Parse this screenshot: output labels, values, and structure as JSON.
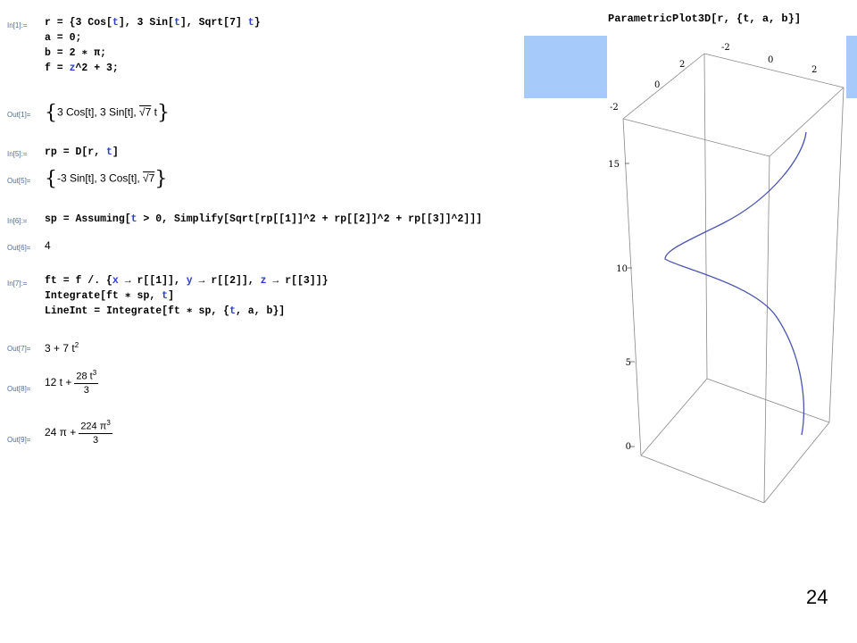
{
  "labels": {
    "in1": "In[1]:=",
    "out1": "Out[1]=",
    "in5": "In[5]:=",
    "out5": "Out[5]=",
    "in6": "In[6]:=",
    "out6": "Out[6]=",
    "in7": "In[7]:=",
    "out7": "Out[7]=",
    "out8": "Out[8]=",
    "out9": "Out[9]="
  },
  "cell1": {
    "line1_a": "r = {3 Cos[",
    "line1_t1": "t",
    "line1_b": "], 3 Sin[",
    "line1_t2": "t",
    "line1_c": "], Sqrt[7] ",
    "line1_t3": "t",
    "line1_d": "}",
    "line2": "a = 0;",
    "line3": "b = 2 ∗ π;",
    "line4_a": "f = ",
    "line4_z": "z",
    "line4_b": "^2 + 3;",
    "output_a": "3 Cos[t], 3 Sin[t], ",
    "output_sqrt": "√7",
    "output_b": " t"
  },
  "cell5": {
    "line1_a": "rp = D[r, ",
    "line1_t": "t",
    "line1_b": "]",
    "output_a": "-3 Sin[t], 3 Cos[t], ",
    "output_sqrt": "√7"
  },
  "cell6": {
    "line1_a": "sp = Assuming[",
    "line1_t": "t",
    "line1_b": " > 0, Simplify[Sqrt[rp[[1]]^2 + rp[[2]]^2 + rp[[3]]^2]]]",
    "output": "4"
  },
  "cell7": {
    "line1_a": "ft = f /. {",
    "line1_x": "x",
    "line1_b": " → r[[1]], ",
    "line1_y": "y",
    "line1_c": " → r[[2]], ",
    "line1_z": "z",
    "line1_d": " → r[[3]]}",
    "line2_a": "Integrate[ft ∗ sp, ",
    "line2_t": "t",
    "line2_b": "]",
    "line3_a": "LineInt = Integrate[ft ∗ sp, {",
    "line3_t": "t",
    "line3_b": ", a, b}]",
    "out7_base": "3 + 7 t",
    "out7_exp": "2",
    "out8_lead": "12 t +",
    "out8_num_base": "28 t",
    "out8_num_exp": "3",
    "out8_den": "3",
    "out9_lead": "24 π +",
    "out9_num_base": "224 π",
    "out9_num_exp": "3",
    "out9_den": "3"
  },
  "plot": {
    "title": "ParametricPlot3D[r, {t, a, b}]",
    "z_ticks": [
      "0",
      "5",
      "10",
      "15"
    ],
    "top_front_ticks": [
      "-2",
      "0",
      "2"
    ],
    "top_back_ticks": [
      "-2",
      "0",
      "2"
    ],
    "curve_color": "#4b55b0"
  },
  "page_number": "24",
  "colors": {
    "input_blue": "#2f3dd6",
    "label_gray": "#4a6e9a",
    "deco_block": "#a6cbfb"
  }
}
